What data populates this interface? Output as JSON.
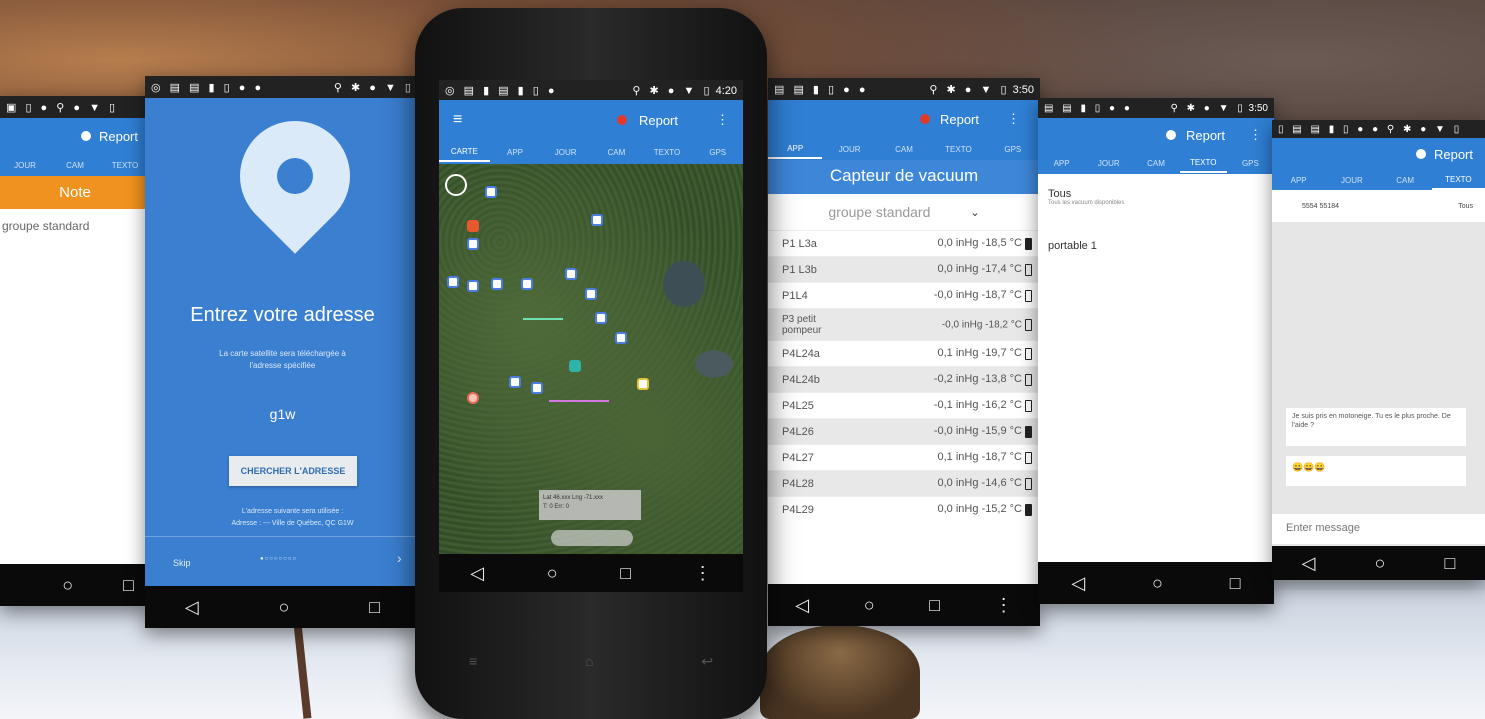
{
  "screen1": {
    "report": "Report",
    "tabs": [
      "JOUR",
      "CAM",
      "TEXTO"
    ],
    "banner": "Note",
    "group": "groupe standard"
  },
  "screen2": {
    "title": "Entrez votre adresse",
    "desc": "La carte satellite sera téléchargée à l'adresse spécifiée",
    "input": "g1w",
    "button": "CHERCHER L'ADRESSE",
    "footnote1": "L'adresse suivante sera utilisée :",
    "footnote2": "Adresse : --- Ville de Québec, QC G1W",
    "skip": "Skip",
    "dots": "●○○○○○○○",
    "next": "›"
  },
  "phone": {
    "time": "4:20",
    "report": "Report",
    "menu": "≡",
    "more": "⋮",
    "tabs": [
      "CARTE",
      "APP",
      "JOUR",
      "CAM",
      "TEXTO",
      "GPS"
    ],
    "coords1": "Lat 46.xxx Lng -71.xxx",
    "coords2": "T: 0 Err: 0"
  },
  "screen4": {
    "time": "3:50",
    "report": "Report",
    "tabs": [
      "APP",
      "JOUR",
      "CAM",
      "TEXTO",
      "GPS"
    ],
    "title": "Capteur de vacuum",
    "group": "groupe standard",
    "rows": [
      {
        "name": "P1 L3a",
        "value": "0,0 inHg -18,5 °C"
      },
      {
        "name": "P1 L3b",
        "value": "0,0 inHg -17,4 °C"
      },
      {
        "name": "P1L4",
        "value": "-0,0 inHg -18,7 °C"
      },
      {
        "name": "P3 petit pompeur",
        "value": "-0,0 inHg -18,2 °C"
      },
      {
        "name": "P4L24a",
        "value": "0,1 inHg -19,7 °C"
      },
      {
        "name": "P4L24b",
        "value": "-0,2 inHg -13,8 °C"
      },
      {
        "name": "P4L25",
        "value": "-0,1 inHg -16,2 °C"
      },
      {
        "name": "P4L26",
        "value": "-0,0 inHg -15,9 °C"
      },
      {
        "name": "P4L27",
        "value": "0,1 inHg -18,7 °C"
      },
      {
        "name": "P4L28",
        "value": "0,0 inHg -14,6 °C"
      },
      {
        "name": "P4L29",
        "value": "0,0 inHg -15,2 °C"
      }
    ]
  },
  "screen5": {
    "time": "3:50",
    "report": "Report",
    "tabs": [
      "APP",
      "JOUR",
      "CAM",
      "TEXTO",
      "GPS"
    ],
    "all": "Tous",
    "all_sub": "Tous les vacuum disponibles",
    "portable": "portable 1"
  },
  "screen6": {
    "report": "Report",
    "tabs": [
      "APP",
      "JOUR",
      "CAM",
      "TEXTO"
    ],
    "contact": "5554 55184",
    "all": "Tous",
    "msg1": "Je suis pris en motoneige. Tu es le plus proche. De l'aide ?",
    "msg2": "😀😀😀",
    "placeholder": "Enter message"
  },
  "nav": {
    "back": "◁",
    "home": "○",
    "recent": "□"
  }
}
